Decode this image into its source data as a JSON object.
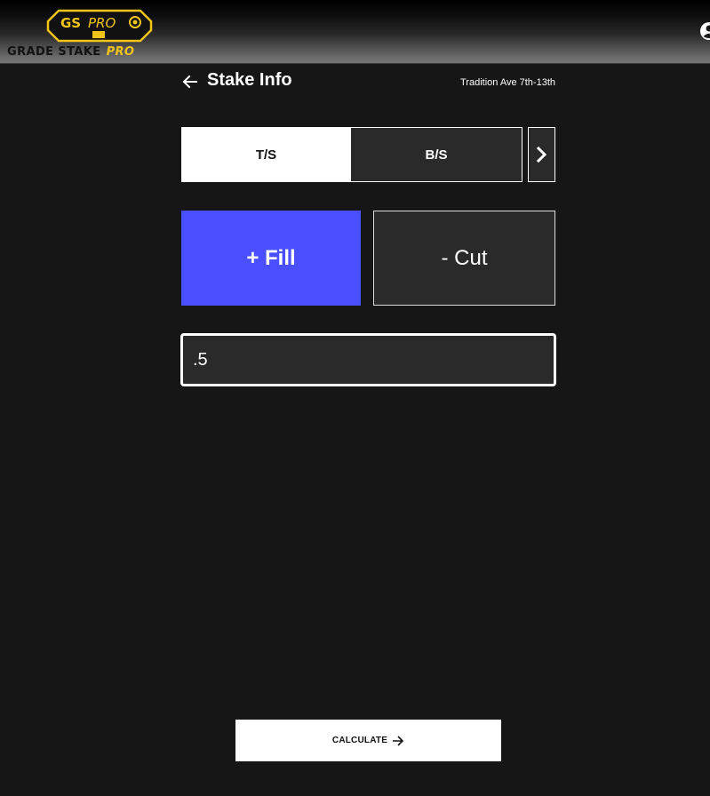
{
  "header": {
    "logo": {
      "badge_text": "GSPRO",
      "wordmark_main": "GRADE STAKE",
      "wordmark_accent": "PRO",
      "accent_color": "#f0c419"
    },
    "user_icon": "account-circle-icon"
  },
  "page": {
    "back_icon": "arrow-left-icon",
    "title": "Stake Info",
    "subtitle": "Tradition Ave 7th-13th"
  },
  "tabs": {
    "items": [
      {
        "label": "T/S",
        "active": true
      },
      {
        "label": "B/S",
        "active": false
      }
    ],
    "next_icon": "chevron-right-icon"
  },
  "mode": {
    "fill_label": "+ Fill",
    "cut_label": "- Cut",
    "selected": "fill",
    "fill_color": "#4a4fff"
  },
  "input": {
    "value": ".5"
  },
  "actions": {
    "calculate_label": "CALCULATE",
    "calculate_icon": "arrow-right-icon"
  }
}
